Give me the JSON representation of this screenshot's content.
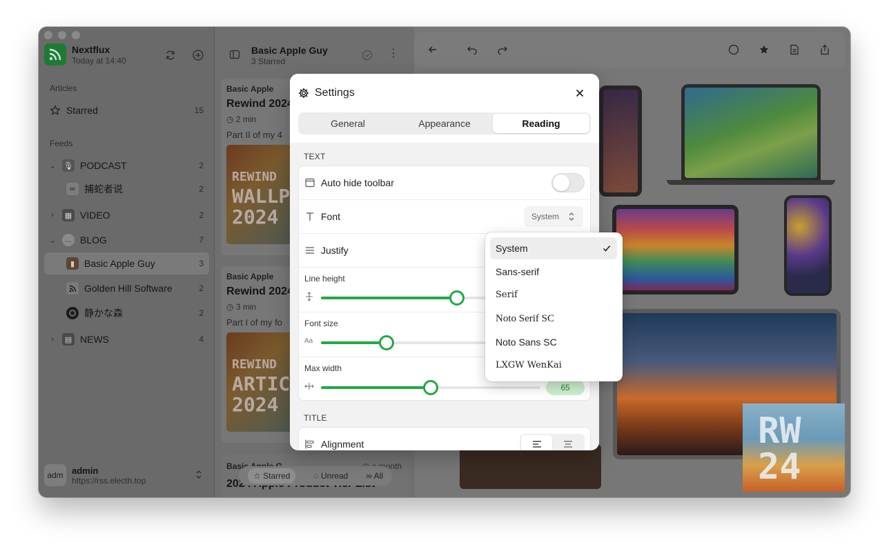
{
  "sidebar": {
    "app_name": "Nextflux",
    "app_time": "Today at 14:40",
    "articles_label": "Articles",
    "starred": {
      "label": "Starred",
      "count": "15"
    },
    "feeds_label": "Feeds",
    "items": [
      {
        "label": "PODCAST",
        "count": "2",
        "icon": "podcast-folder-icon"
      },
      {
        "label": "捕蛇者说",
        "count": "2",
        "icon": "feed-icon"
      },
      {
        "label": "VIDEO",
        "count": "2",
        "icon": "video-folder-icon"
      },
      {
        "label": "BLOG",
        "count": "7",
        "icon": "blog-folder-icon"
      },
      {
        "label": "Basic Apple Guy",
        "count": "3",
        "icon": "feed-icon"
      },
      {
        "label": "Golden Hill Software",
        "count": "2",
        "icon": "rss-icon"
      },
      {
        "label": "静かな森",
        "count": "2",
        "icon": "feed-icon"
      },
      {
        "label": "NEWS",
        "count": "4",
        "icon": "news-folder-icon"
      }
    ],
    "user": {
      "avatar": "adm",
      "name": "admin",
      "url": "https://rss.electh.top"
    }
  },
  "list": {
    "title": "Basic Apple Guy",
    "subtitle": "3 Starred",
    "cards": [
      {
        "feed": "Basic Apple",
        "title": "Rewind 2024",
        "meta": "2 min",
        "excerpt": "Part II of my 4",
        "thumb_lines": [
          "REWIND",
          "WALLP",
          "2024"
        ]
      },
      {
        "feed": "Basic Apple",
        "title": "Rewind 2024",
        "meta": "3 min",
        "excerpt": "Part I of my fo",
        "thumb_lines": [
          "REWIND",
          "ARTIC",
          "2024"
        ]
      }
    ],
    "bottom_card": {
      "feed": "Basic Apple G",
      "age": "a month",
      "title": "2024 Apple Product Tier List"
    },
    "filters": {
      "starred": "Starred",
      "unread": "Unread",
      "all": "All"
    }
  },
  "reader": {
    "tile_text": [
      "RW",
      "24"
    ]
  },
  "settings": {
    "title": "Settings",
    "tabs": [
      "General",
      "Appearance",
      "Reading"
    ],
    "active_tab": "Reading",
    "text_section": "TEXT",
    "auto_hide_toolbar": "Auto hide toolbar",
    "font_label": "Font",
    "font_value": "System",
    "justify_label": "Justify",
    "line_height_label": "Line height",
    "line_height_level": 0.62,
    "font_size_label": "Font size",
    "font_size_level": 0.3,
    "max_width_label": "Max width",
    "max_width_value": "65",
    "max_width_level": 0.5,
    "title_section": "TITLE",
    "alignment_label": "Alignment"
  },
  "font_menu": {
    "options": [
      "System",
      "Sans-serif",
      "Serif",
      "Noto Serif SC",
      "Noto Sans SC",
      "LXGW WenKai"
    ],
    "selected": "System"
  },
  "colors": {
    "accent": "#22a845",
    "logo": "#2da44e"
  }
}
